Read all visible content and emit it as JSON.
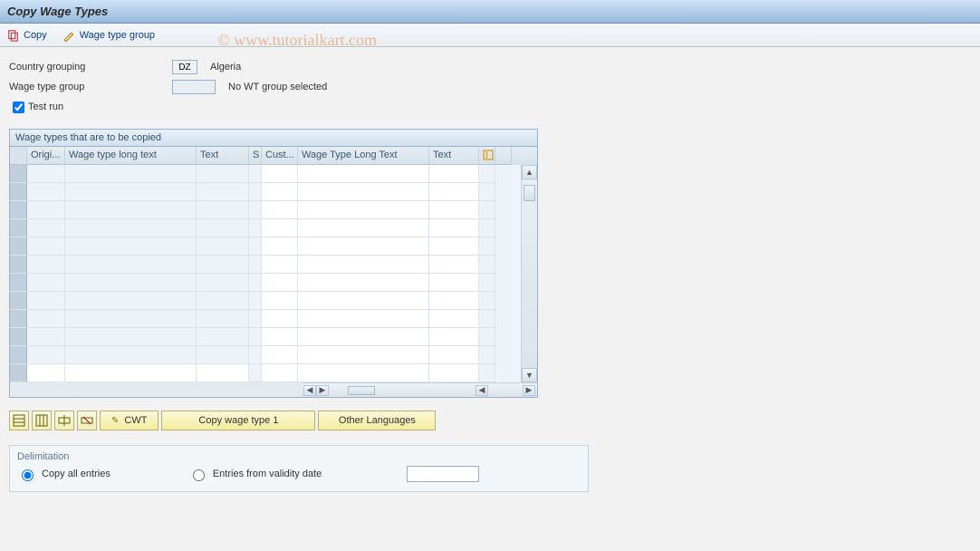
{
  "title": "Copy Wage Types",
  "toolbar": {
    "copy_label": "Copy",
    "wtg_label": "Wage type group"
  },
  "watermark": "© www.tutorialkart.com",
  "form": {
    "country_label": "Country grouping",
    "country_value": "DZ",
    "country_text": "Algeria",
    "wtg_label": "Wage type group",
    "wtg_value": "",
    "wtg_text": "No WT group selected",
    "test_run_label": "Test run",
    "test_run_checked": true
  },
  "grid": {
    "title": "Wage types that are to be copied",
    "headers": {
      "origi": "Origi...",
      "wtlong1": "Wage type long text",
      "text1": "Text",
      "s": "S",
      "cust": "Cust...",
      "wtlong2": "Wage Type Long Text",
      "text2": "Text"
    },
    "row_count": 12
  },
  "buttons": {
    "cwt": "CWT",
    "copy_wt1": "Copy wage type 1",
    "other_lang": "Other Languages"
  },
  "delimitation": {
    "legend": "Delimitation",
    "copy_all": "Copy all entries",
    "from_date": "Entries from validity date",
    "date_value": ""
  }
}
